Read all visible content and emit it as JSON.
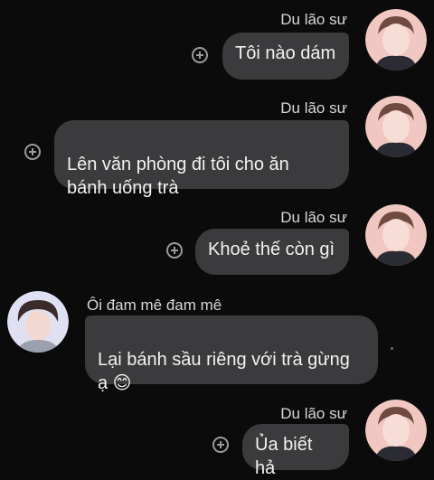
{
  "messages": [
    {
      "sender": "Du lão sư",
      "text": "Tôi nào dám",
      "side": "right",
      "avatar_icon": "person-avatar-icon"
    },
    {
      "sender": "Du lão sư",
      "text": "Lên văn phòng đi tôi cho ăn\nbánh uống trà",
      "side": "right",
      "avatar_icon": "person-avatar-icon"
    },
    {
      "sender": "Du lão sư",
      "text": "Khoẻ thế còn gì",
      "side": "right",
      "avatar_icon": "person-avatar-icon"
    },
    {
      "sender": "Ôi đam mê đam mê",
      "text": "Lại bánh sầu riêng với trà gừng\nạ 😊",
      "side": "left",
      "avatar_icon": "person-avatar-icon"
    },
    {
      "sender": "Du lão sư",
      "text": "Ủa biết hả",
      "side": "right",
      "avatar_icon": "person-avatar-icon"
    }
  ],
  "icons": {
    "reaction": "add-reaction-icon"
  },
  "colors": {
    "background": "#0b0b0c",
    "bubble": "#3b3b3d",
    "avatar_bg_right": "#f0c7c1",
    "avatar_bg_left": "#dfe1f3"
  }
}
